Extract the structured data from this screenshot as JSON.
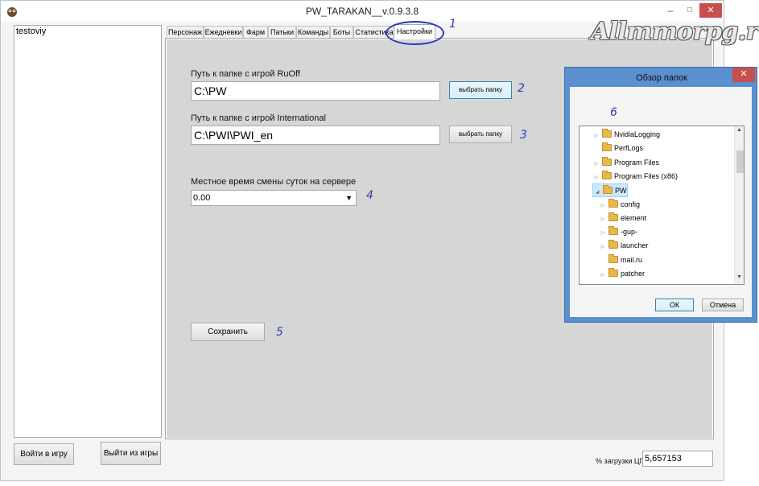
{
  "window": {
    "title": "PW_TARAKAN__v.0.9.3.8",
    "minimize_glyph": "–",
    "maximize_glyph": "□",
    "close_glyph": "✕"
  },
  "accounts": {
    "items": [
      "testoviy"
    ]
  },
  "buttons": {
    "login": "Войти в игру",
    "logout": "Выйти из игры",
    "save": "Сохранить"
  },
  "tabs": [
    {
      "label": "Персонаж"
    },
    {
      "label": "Ежедневки"
    },
    {
      "label": "Фарм"
    },
    {
      "label": "Патьки"
    },
    {
      "label": "Команды"
    },
    {
      "label": "Боты"
    },
    {
      "label": "Статистика"
    },
    {
      "label": "Настройки",
      "active": true
    }
  ],
  "settings": {
    "ruoff_label": "Путь к папке с игрой  RuOff",
    "ruoff_path": "C:\\PW",
    "intl_label": "Путь к папке с игрой  International",
    "intl_path": "C:\\PWI\\PWI_en",
    "browse_label": "выбрать папку",
    "time_label": "Местное время смены суток на сервере",
    "time_value": "0.00"
  },
  "cpu": {
    "label": "% загрузки ЦП",
    "value": "5,657153"
  },
  "annotations": [
    "1",
    "2",
    "3",
    "4",
    "5",
    "6"
  ],
  "watermark": "Allmmorpg.ru",
  "folder_dialog": {
    "title": "Обзор папок",
    "ok": "ОК",
    "cancel": "Отмена",
    "tree": [
      {
        "label": "NvidiaLogging",
        "expander": "collapsed",
        "level": 0
      },
      {
        "label": "PerfLogs",
        "expander": "none",
        "level": 0
      },
      {
        "label": "Program Files",
        "expander": "collapsed",
        "level": 0
      },
      {
        "label": "Program Files (x86)",
        "expander": "collapsed",
        "level": 0
      },
      {
        "label": "PW",
        "expander": "expanded",
        "level": 0,
        "selected": true
      },
      {
        "label": "config",
        "expander": "collapsed",
        "level": 1
      },
      {
        "label": "element",
        "expander": "collapsed",
        "level": 1
      },
      {
        "label": "-gup-",
        "expander": "collapsed",
        "level": 1
      },
      {
        "label": "launcher",
        "expander": "collapsed",
        "level": 1
      },
      {
        "label": "mail.ru",
        "expander": "none",
        "level": 1
      },
      {
        "label": "patcher",
        "expander": "collapsed",
        "level": 1
      }
    ]
  },
  "colors": {
    "accent_annotation": "#2b3fb0",
    "close_red": "#c7504c",
    "panel_gray": "#d6d6d6"
  }
}
